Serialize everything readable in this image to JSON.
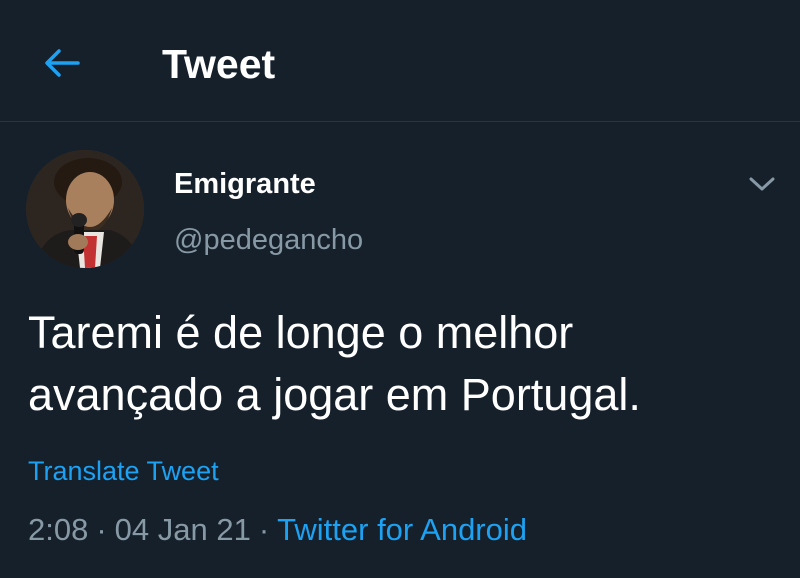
{
  "header": {
    "back_icon": "arrow-left-icon",
    "title": "Tweet"
  },
  "tweet": {
    "author": {
      "display_name": "Emigrante",
      "handle": "@pedegancho",
      "avatar_desc": "profile photo"
    },
    "more_icon": "chevron-down-icon",
    "text": "Taremi é de longe o melhor avançado a jogar em Portugal.",
    "translate_label": "Translate Tweet",
    "time": "2:08",
    "date": "04 Jan 21",
    "separator": "·",
    "source": "Twitter for Android"
  },
  "colors": {
    "background": "#15202b",
    "accent": "#1da1f2",
    "secondary_text": "#8899a6",
    "primary_text": "#ffffff",
    "divider": "#2a3540"
  }
}
